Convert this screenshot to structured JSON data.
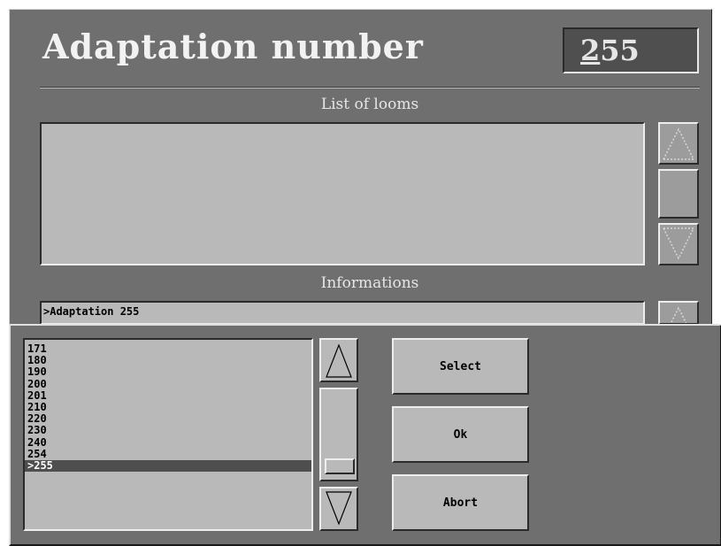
{
  "window": {
    "title": "Adaptation number",
    "number_prefix": "2",
    "number_rest": "55"
  },
  "looms": {
    "label": "List of looms",
    "items": []
  },
  "informations": {
    "label": "Informations",
    "text": ">Adaptation 255"
  },
  "dialog": {
    "list": [
      {
        "value": "171",
        "selected": false
      },
      {
        "value": "180",
        "selected": false
      },
      {
        "value": "190",
        "selected": false
      },
      {
        "value": "200",
        "selected": false
      },
      {
        "value": "201",
        "selected": false
      },
      {
        "value": "210",
        "selected": false
      },
      {
        "value": "220",
        "selected": false
      },
      {
        "value": "230",
        "selected": false
      },
      {
        "value": "240",
        "selected": false
      },
      {
        "value": "254",
        "selected": false
      },
      {
        "value": ">255",
        "selected": true
      }
    ],
    "buttons": {
      "select": "Select",
      "ok": "Ok",
      "abort": "Abort"
    }
  },
  "icons": {
    "up": "arrow-up-icon",
    "down": "arrow-down-icon"
  },
  "colors": {
    "background": "#6f6f6f",
    "field": "#b9b9b9",
    "selection": "#4e4e4e"
  }
}
